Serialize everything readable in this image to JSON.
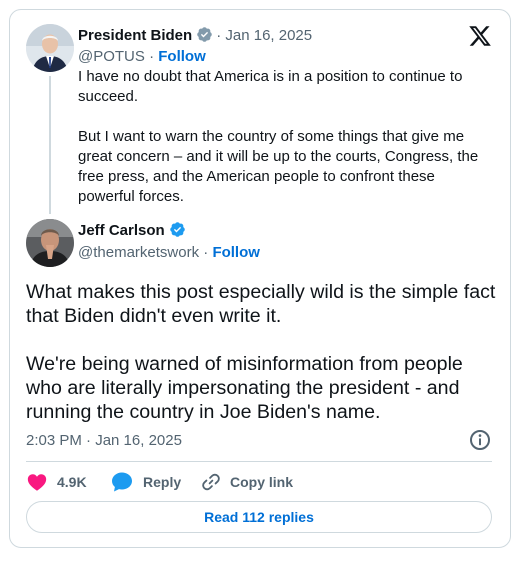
{
  "parent_tweet": {
    "author_name": "President Biden",
    "handle": "@POTUS",
    "separator": "·",
    "date": "Jan 16, 2025",
    "follow_label": "Follow",
    "paragraphs": [
      "I have no doubt that America is in a position to continue to succeed.",
      "But I want to warn the country of some things that give me great concern – and it will be up to the courts, Congress, the free press, and the American people to confront these powerful forces."
    ]
  },
  "main_tweet": {
    "author_name": "Jeff Carlson",
    "handle": "@themarketswork",
    "separator": "·",
    "follow_label": "Follow",
    "paragraphs": [
      "What makes this post especially wild is the simple fact that Biden didn't even write it.",
      "We're being warned of misinformation from people who are literally impersonating the president - and running the country in Joe Biden's name."
    ],
    "timestamp": "2:03 PM · Jan 16, 2025"
  },
  "actions": {
    "likes_count": "4.9K",
    "reply_label": "Reply",
    "copy_link_label": "Copy link"
  },
  "replies_button_label": "Read 112 replies",
  "icons": {
    "brand": "x-logo-icon",
    "verified": "verified-badge-icon",
    "info": "info-icon",
    "like": "heart-icon",
    "reply": "speech-bubble-icon",
    "copy": "link-icon"
  },
  "colors": {
    "accent": "#1d9bf0",
    "link": "#006fd6",
    "like": "#f91880",
    "text": "#0f1419",
    "muted": "#536471",
    "border": "#cfd9de"
  }
}
